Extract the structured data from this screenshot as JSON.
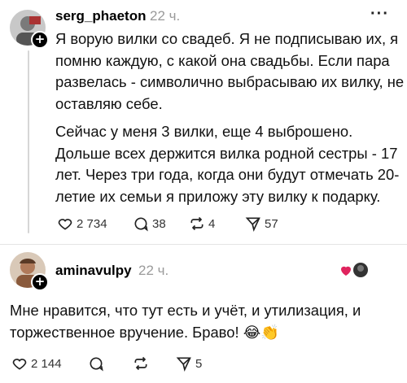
{
  "post1": {
    "username": "serg_phaeton",
    "time": "22 ч.",
    "more_label": "···",
    "plus": "+",
    "paragraph1_lines": [
      "Я ворую вилки со свадеб. Я не подписываю их, я",
      "помню каждую, с какой она свадьбы. Если пара",
      "развелась - символично выбрасываю их вилку, не",
      "оставляю себе."
    ],
    "paragraph2_lines": [
      "Сейчас у меня 3 вилки, еще 4 выброшено.",
      "Дольше всех держится вилка родной сестры - 17",
      "лет. Через три года, когда они будут отмечать 20-",
      "летие их семьи я приложу эту вилку к подарку."
    ],
    "likes": "2 734",
    "comments": "38",
    "reposts": "4",
    "shares": "57"
  },
  "post2": {
    "username": "aminavulpy",
    "time": "22 ч.",
    "more_label": "···",
    "plus": "+",
    "text_lines": [
      "Мне нравится, что тут есть и учёт, и утилизация, и",
      "торжественное вручение. Браво!"
    ],
    "emoji_1": "😂",
    "emoji_2": "👏",
    "likes": "2 144",
    "shares": "5"
  },
  "colors": {
    "text": "#111111",
    "muted": "#9a9a9a",
    "thread_line": "#d6d6d6"
  },
  "icons": [
    "heart-icon",
    "comment-icon",
    "repost-icon",
    "send-icon",
    "more-icon",
    "follow-plus-icon"
  ]
}
